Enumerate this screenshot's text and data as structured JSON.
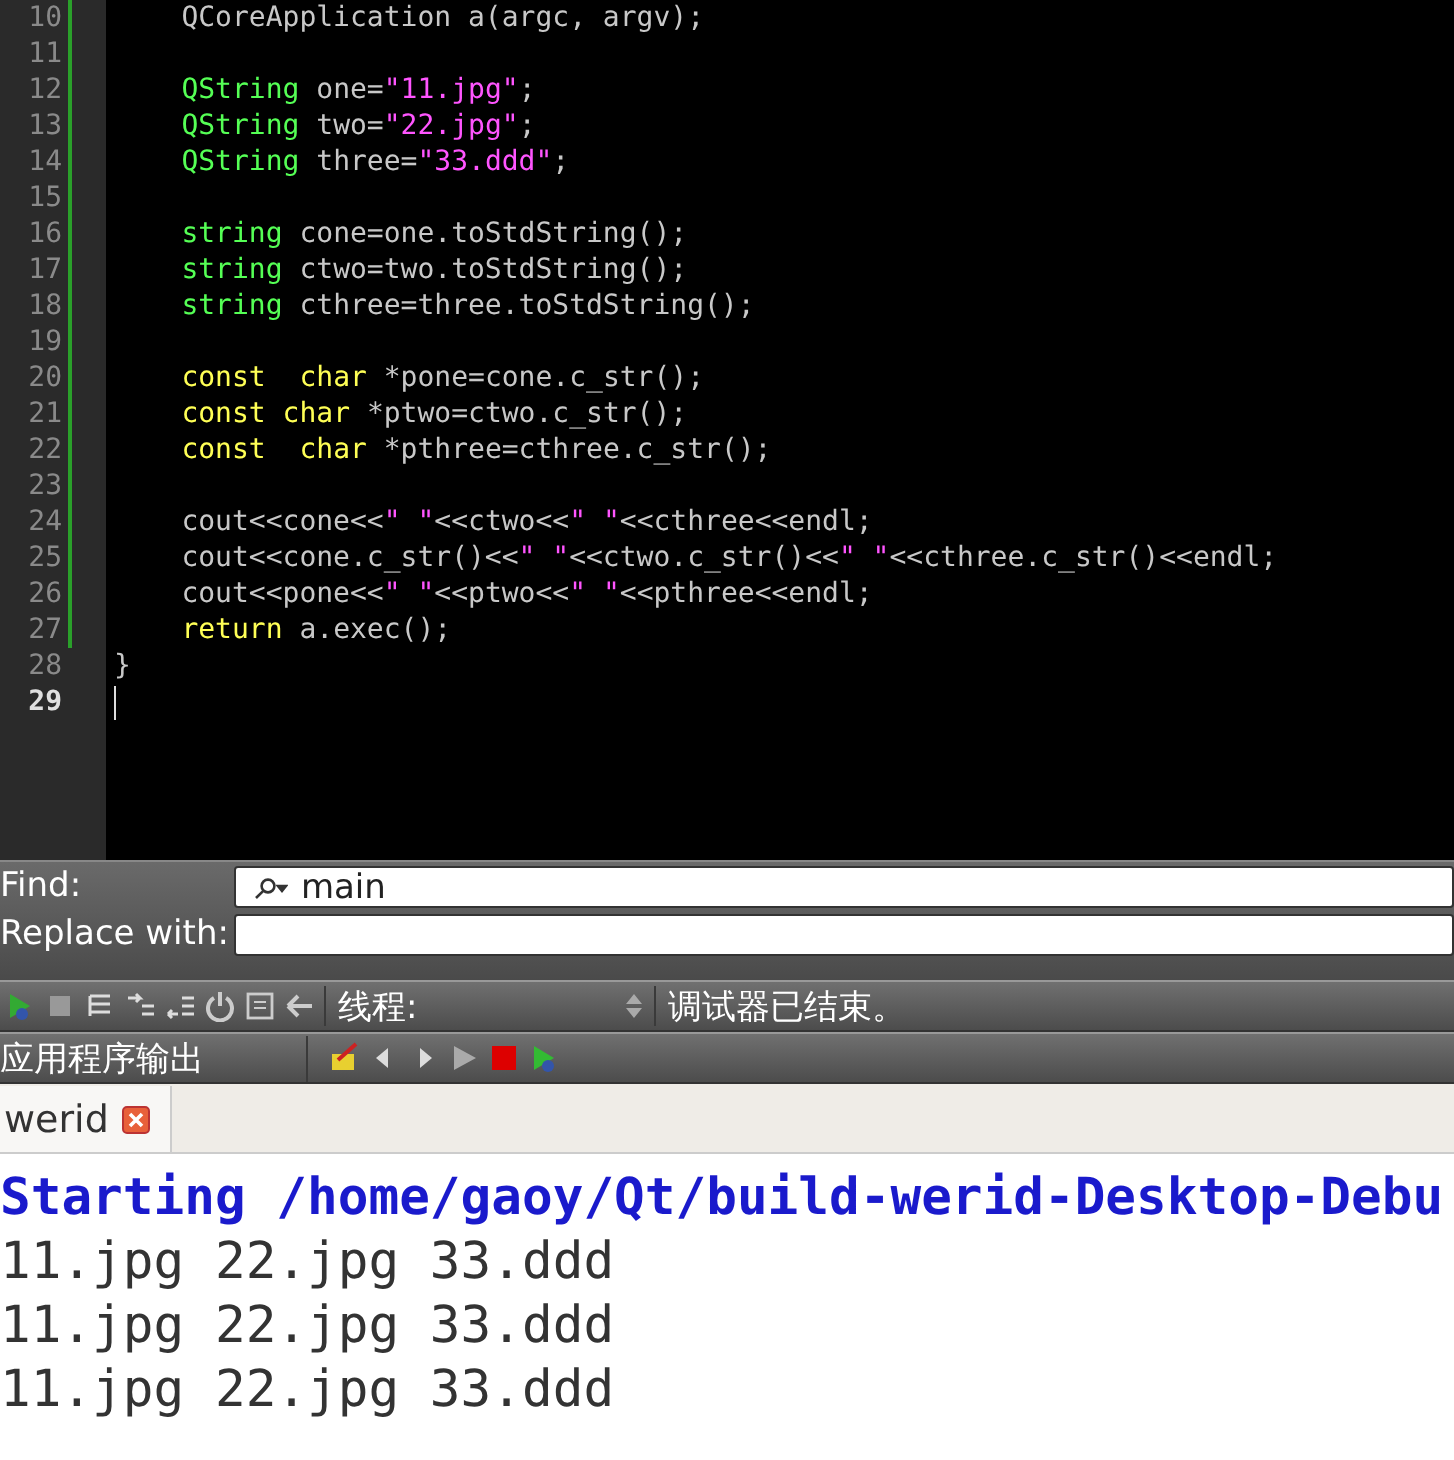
{
  "editor": {
    "lines": [
      {
        "number": "10",
        "current": false,
        "modified": true,
        "indented": true,
        "tokens": [
          {
            "kind": "plain",
            "text": "QCoreApplication a(argc, argv);"
          }
        ]
      },
      {
        "number": "11",
        "current": false,
        "modified": true,
        "indented": false
      },
      {
        "number": "12",
        "current": false,
        "modified": true,
        "indented": true,
        "tokens": [
          {
            "kind": "type",
            "text": "QString"
          },
          {
            "kind": "plain",
            "text": " one="
          },
          {
            "kind": "string",
            "text": "\"11.jpg\""
          },
          {
            "kind": "plain",
            "text": ";"
          }
        ]
      },
      {
        "number": "13",
        "current": false,
        "modified": true,
        "indented": true,
        "tokens": [
          {
            "kind": "type",
            "text": "QString"
          },
          {
            "kind": "plain",
            "text": " two="
          },
          {
            "kind": "string",
            "text": "\"22.jpg\""
          },
          {
            "kind": "plain",
            "text": ";"
          }
        ]
      },
      {
        "number": "14",
        "current": false,
        "modified": true,
        "indented": true,
        "tokens": [
          {
            "kind": "type",
            "text": "QString"
          },
          {
            "kind": "plain",
            "text": " three="
          },
          {
            "kind": "string",
            "text": "\"33.ddd\""
          },
          {
            "kind": "plain",
            "text": ";"
          }
        ]
      },
      {
        "number": "15",
        "current": false,
        "modified": true,
        "indented": false
      },
      {
        "number": "16",
        "current": false,
        "modified": true,
        "indented": true,
        "tokens": [
          {
            "kind": "type",
            "text": "string"
          },
          {
            "kind": "plain",
            "text": " cone=one.toStdString();"
          }
        ]
      },
      {
        "number": "17",
        "current": false,
        "modified": true,
        "indented": true,
        "tokens": [
          {
            "kind": "type",
            "text": "string"
          },
          {
            "kind": "plain",
            "text": " ctwo=two.toStdString();"
          }
        ]
      },
      {
        "number": "18",
        "current": false,
        "modified": true,
        "indented": true,
        "tokens": [
          {
            "kind": "type",
            "text": "string"
          },
          {
            "kind": "plain",
            "text": " cthree=three.toStdString();"
          }
        ]
      },
      {
        "number": "19",
        "current": false,
        "modified": true,
        "indented": false
      },
      {
        "number": "20",
        "current": false,
        "modified": true,
        "indented": true,
        "tokens": [
          {
            "kind": "keyword",
            "text": "const"
          },
          {
            "kind": "keyword",
            "text": "  char"
          },
          {
            "kind": "plain",
            "text": " *pone=cone.c_str();"
          }
        ]
      },
      {
        "number": "21",
        "current": false,
        "modified": true,
        "indented": true,
        "tokens": [
          {
            "kind": "keyword",
            "text": "const"
          },
          {
            "kind": "keyword",
            "text": " char"
          },
          {
            "kind": "plain",
            "text": " *ptwo=ctwo.c_str();"
          }
        ]
      },
      {
        "number": "22",
        "current": false,
        "modified": true,
        "indented": true,
        "tokens": [
          {
            "kind": "keyword",
            "text": "const"
          },
          {
            "kind": "keyword",
            "text": "  char"
          },
          {
            "kind": "plain",
            "text": " *pthree=cthree.c_str();"
          }
        ]
      },
      {
        "number": "23",
        "current": false,
        "modified": true,
        "indented": false
      },
      {
        "number": "24",
        "current": false,
        "modified": true,
        "indented": true,
        "tokens": [
          {
            "kind": "plain",
            "text": "cout<<cone<<"
          },
          {
            "kind": "string",
            "text": "\" \""
          },
          {
            "kind": "plain",
            "text": "<<ctwo<<"
          },
          {
            "kind": "string",
            "text": "\" \""
          },
          {
            "kind": "plain",
            "text": "<<cthree<<endl;"
          }
        ]
      },
      {
        "number": "25",
        "current": false,
        "modified": true,
        "indented": true,
        "tokens": [
          {
            "kind": "plain",
            "text": "cout<<cone.c_str()<<"
          },
          {
            "kind": "string",
            "text": "\" \""
          },
          {
            "kind": "plain",
            "text": "<<ctwo.c_str()<<"
          },
          {
            "kind": "string",
            "text": "\" \""
          },
          {
            "kind": "plain",
            "text": "<<cthree.c_str()<<endl;"
          }
        ]
      },
      {
        "number": "26",
        "current": false,
        "modified": true,
        "indented": true,
        "tokens": [
          {
            "kind": "plain",
            "text": "cout<<pone<<"
          },
          {
            "kind": "string",
            "text": "\" \""
          },
          {
            "kind": "plain",
            "text": "<<ptwo<<"
          },
          {
            "kind": "string",
            "text": "\" \""
          },
          {
            "kind": "plain",
            "text": "<<pthree<<endl;"
          }
        ]
      },
      {
        "number": "27",
        "current": false,
        "modified": true,
        "indented": true,
        "tokens": [
          {
            "kind": "keyword",
            "text": "return"
          },
          {
            "kind": "plain",
            "text": " a.exec();"
          }
        ]
      },
      {
        "number": "28",
        "current": false,
        "modified": false,
        "indented": false,
        "tokens": [
          {
            "kind": "plain",
            "text": "}"
          }
        ]
      },
      {
        "number": "29",
        "current": true,
        "modified": false,
        "indented": false
      }
    ]
  },
  "find_bar": {
    "find_label": "Find:",
    "find_value": "main",
    "replace_label": "Replace with:"
  },
  "debug_toolbar": {
    "thread_label": "线程:",
    "status": "调试器已结束。"
  },
  "output_pane": {
    "title": "应用程序输出",
    "tabs": [
      {
        "label": "werid",
        "selected": true
      }
    ],
    "lines": [
      {
        "kind": "info",
        "text": "Starting /home/gaoy/Qt/build-werid-Desktop-Debu"
      },
      {
        "kind": "stdout",
        "text": "11.jpg 22.jpg 33.ddd"
      },
      {
        "kind": "stdout",
        "text": "11.jpg 22.jpg 33.ddd"
      },
      {
        "kind": "stdout",
        "text": "11.jpg 22.jpg 33.ddd"
      }
    ]
  }
}
